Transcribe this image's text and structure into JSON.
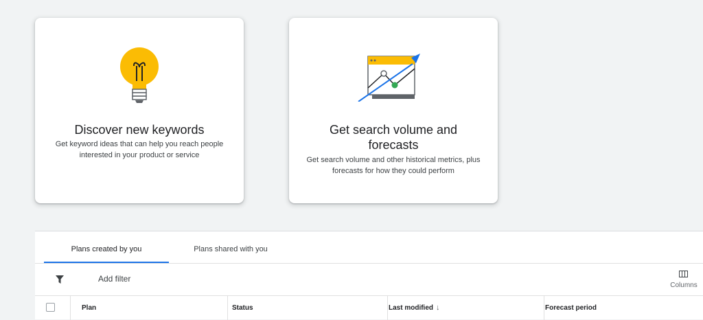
{
  "cards": [
    {
      "title": "Discover new keywords",
      "description": "Get keyword ideas that can help you reach people interested in your product or service",
      "icon": "lightbulb-icon"
    },
    {
      "title": "Get search volume and forecasts",
      "description": "Get search volume and other historical metrics, plus forecasts for how they could perform",
      "icon": "trending-chart-icon"
    }
  ],
  "tabs": [
    {
      "label": "Plans created by you",
      "active": true
    },
    {
      "label": "Plans shared with you",
      "active": false
    }
  ],
  "filterbar": {
    "add_filter_label": "Add filter",
    "columns_label": "Columns"
  },
  "table": {
    "headers": {
      "plan": "Plan",
      "status": "Status",
      "last_modified": "Last modified",
      "forecast_period": "Forecast period"
    },
    "sort_indicator": "↓"
  },
  "colors": {
    "accent": "#1a73e8",
    "bulb": "#fbbc04",
    "chart_yellow": "#fbbc04",
    "chart_green": "#34a853",
    "background": "#f1f3f4"
  }
}
